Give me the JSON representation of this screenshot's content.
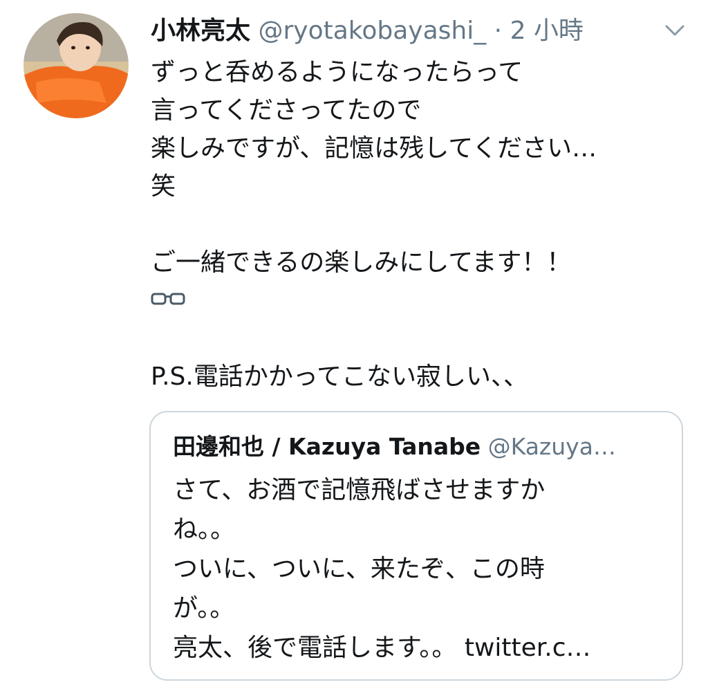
{
  "tweet": {
    "display_name": "小林亮太",
    "handle": "@ryotakobayashi_",
    "separator": " · ",
    "timestamp": "2 小時",
    "text_lines": {
      "l1": "ずっと呑めるようになったらって",
      "l2": "言ってくださってたので",
      "l3": "楽しみですが、記憶は残してください…",
      "l4": "笑",
      "l5": "ご一緒できるの楽しみにしてます！！",
      "l6": "P.S.電話かかってこない寂しい、、"
    },
    "emoji": "glasses-emoji"
  },
  "quoted_tweet": {
    "display_name": "田邊和也 / Kazuya Tanabe",
    "handle": "@Kazuya…",
    "text_lines": {
      "l1": "さて、お酒で記憶飛ばさせますか",
      "l2": "ね。。",
      "l3": "ついに、ついに、来たぞ、この時",
      "l4": "が。。",
      "l5": "亮太、後で電話します。。 twitter.c…"
    }
  },
  "icons": {
    "menu": "chevron-down-icon",
    "avatar": "avatar-photo"
  },
  "colors": {
    "text_primary": "#14171a",
    "text_secondary": "#657786",
    "border": "#ccd6dd",
    "background": "#ffffff"
  }
}
